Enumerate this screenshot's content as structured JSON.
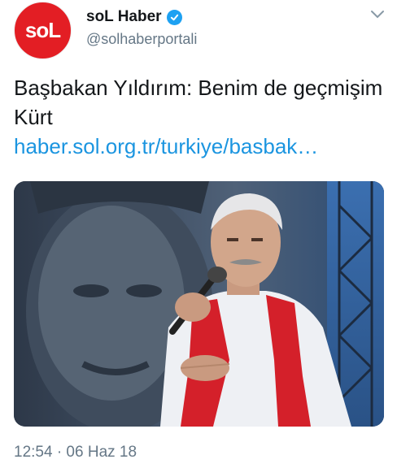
{
  "author": {
    "avatar_text": "soL",
    "display_name": "soL Haber",
    "handle": "@solhaberportali",
    "verified": true
  },
  "tweet": {
    "text": "Başbakan Yıldırım: Benim de geçmişim Kürt",
    "link": "haber.sol.org.tr/turkiye/basbak…",
    "timestamp": "12:54 · 06 Haz 18"
  },
  "colors": {
    "brand_red": "#e31e24",
    "link_blue": "#1b95e0",
    "verified_blue": "#1da1f2",
    "secondary_text": "#657786"
  },
  "icons": {
    "verified": "verified-badge-icon",
    "menu": "chevron-down-icon"
  }
}
